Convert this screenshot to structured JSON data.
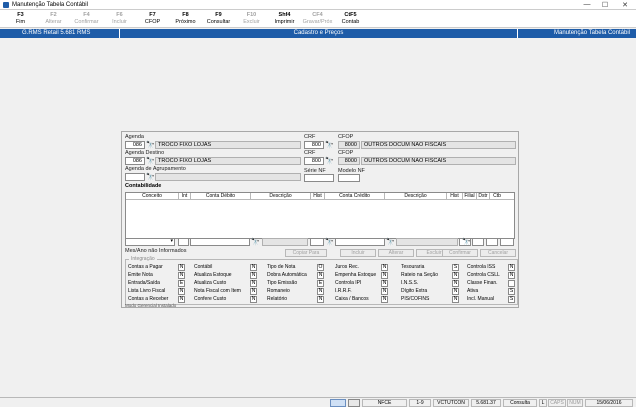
{
  "window": {
    "title": "Manutenção Tabela Contábil"
  },
  "toolbar": [
    {
      "key": "F3",
      "label": "Fim",
      "enabled": true
    },
    {
      "key": "F2",
      "label": "Alterar",
      "enabled": false
    },
    {
      "key": "F4",
      "label": "Confirmar",
      "enabled": false
    },
    {
      "key": "F6",
      "label": "Incluir",
      "enabled": false
    },
    {
      "key": "F7",
      "label": "CFOP",
      "enabled": true
    },
    {
      "key": "F8",
      "label": "Próximo",
      "enabled": true
    },
    {
      "key": "F9",
      "label": "Consultar",
      "enabled": true
    },
    {
      "key": "F10",
      "label": "Excluir",
      "enabled": false
    },
    {
      "key": "Shf4",
      "label": "Imprimir",
      "enabled": true
    },
    {
      "key": "CF4",
      "label": "Gravar/Próx",
      "enabled": false
    },
    {
      "key": "CtF5",
      "label": "Contab",
      "enabled": true
    }
  ],
  "header": {
    "left": "G.RMS Retail 5.681 RMS",
    "center": "Cadastro e Preços",
    "right": "Manutenção Tabela Contábil"
  },
  "form": {
    "agenda_label": "Agenda",
    "agenda_code": "086",
    "agenda_desc": "TROCO FIXO LOJAS",
    "crf1_label": "CRF",
    "crf1_value": "800",
    "cfop1_label": "CFOP",
    "cfop1_code": "8000",
    "cfop1_desc": "OUTROS DOCUM NAO FISCAIS",
    "agenda_destino_label": "Agenda Destino",
    "agenda_destino_code": "086",
    "agenda_destino_desc": "TROCO FIXO LOJAS",
    "crf2_label": "CRF",
    "crf2_value": "800",
    "cfop2_label": "CFOP",
    "cfop2_code": "8000",
    "cfop2_desc": "OUTROS DOCUM NAO FISCAIS",
    "agrupamento_label": "Agenda de Agrupamento",
    "serie_nf_label": "Série NF",
    "modelo_nf_label": "Modelo NF"
  },
  "contabilidade": {
    "title": "Contabilidade",
    "columns": [
      "Conceito",
      "Int",
      "Conta Débito",
      "Descrição",
      "Hist",
      "Conta Crédito",
      "Descrição",
      "Hist",
      "Filial",
      "Dstr",
      "Ctb"
    ],
    "mes_ano": "Mes/Ano não Informados",
    "buttons": {
      "copiar": "Copiar Para",
      "incluir": "Incluir",
      "alterar": "Alterar",
      "excluir": "Excluir",
      "confirmar": "Confirmar",
      "cancelar": "Cancelar"
    }
  },
  "integracao": {
    "legend": "Integração",
    "items": [
      {
        "label": "Contas a Pagar",
        "value": "N"
      },
      {
        "label": "Emite Nota",
        "value": "N"
      },
      {
        "label": "Entrada/Saída",
        "value": "E"
      },
      {
        "label": "Lista Livro Fiscal",
        "value": "N"
      },
      {
        "label": "Contas a Receber",
        "value": "N"
      },
      {
        "label": "Contábil",
        "value": "N"
      },
      {
        "label": "Atualiza Estoque",
        "value": "N"
      },
      {
        "label": "Atualiza Custo",
        "value": "N"
      },
      {
        "label": "Nota Fiscal com Item",
        "value": "N"
      },
      {
        "label": "Confere Custo",
        "value": "N"
      },
      {
        "label": "Tipo de Nota",
        "value": "O"
      },
      {
        "label": "Dobra Automática",
        "value": "N"
      },
      {
        "label": "Tipo Emissão",
        "value": "E"
      },
      {
        "label": "Romaneio",
        "value": "N"
      },
      {
        "label": "Relatório",
        "value": "N"
      },
      {
        "label": "Juros Rec.",
        "value": "N"
      },
      {
        "label": "Empenha Estoque",
        "value": "N"
      },
      {
        "label": "Controla IPI",
        "value": "N"
      },
      {
        "label": "I.R.R.F.",
        "value": "N"
      },
      {
        "label": "Caixa / Bancos",
        "value": "N"
      },
      {
        "label": "Tesouraria",
        "value": "S"
      },
      {
        "label": "Rateio na Seção",
        "value": "N"
      },
      {
        "label": "I.N.S.S.",
        "value": "N"
      },
      {
        "label": "Dígito Extra",
        "value": "N"
      },
      {
        "label": "PIS/COFINS",
        "value": "N"
      },
      {
        "label": "Controla ISS",
        "value": "N"
      },
      {
        "label": "Controla CSLL",
        "value": "N"
      },
      {
        "label": "Classe Finan.",
        "value": ""
      },
      {
        "label": "Ativa",
        "value": "S"
      },
      {
        "label": "Incl. Manual",
        "value": "S"
      }
    ],
    "modo": "Modo Gerencial Instalado"
  },
  "status": {
    "nfce": "NFCE",
    "page": "1-9",
    "user": "VCTUTCON",
    "version": "5.681.37",
    "mode": "Consulta",
    "l": "L",
    "caps": "CAPS",
    "num": "NUM",
    "date": "15/06/2016"
  }
}
